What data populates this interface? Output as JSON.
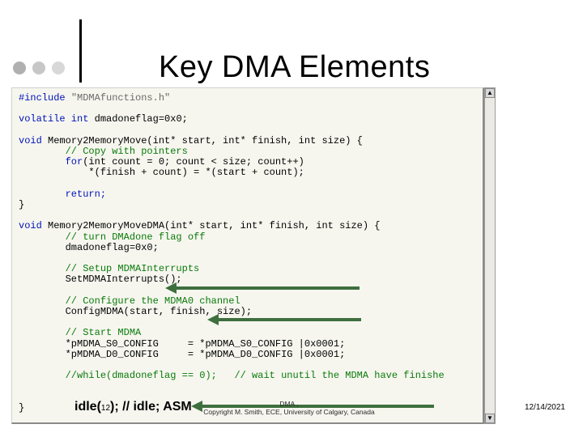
{
  "title": "Key DMA Elements",
  "code": {
    "include_kw": "#include",
    "include_path": "\"MDMAfunctions.h\"",
    "vol_kw": "volatile int",
    "vol_rest": " dmadoneflag=0x0;",
    "fn1_sig_kw": "void",
    "fn1_sig_rest": " Memory2MemoryMove(int* start, int* finish, int size) {",
    "fn1_c1": "// Copy with pointers",
    "fn1_for_kw": "for",
    "fn1_for_rest": "(int count = 0; count < size; count++)",
    "fn1_body": "*(finish + count) = *(start + count);",
    "return_kw": "return;",
    "brace_close": "}",
    "fn2_sig_kw": "void",
    "fn2_sig_rest": " Memory2MemoryMoveDMA(int* start, int* finish, int size) {",
    "fn2_c1": "// turn DMAdone flag off",
    "fn2_l1": "dmadoneflag=0x0;",
    "fn2_c2": "// Setup MDMAInterrupts",
    "fn2_l2": "SetMDMAInterrupts();",
    "fn2_c3": "// Configure the MDMA0 channel",
    "fn2_l3": "ConfigMDMA(start, finish, size);",
    "fn2_c4": "// Start MDMA",
    "fn2_l4a": "*pMDMA_S0_CONFIG",
    "fn2_l4b": "= *pMDMA_S0_CONFIG |0x0001;",
    "fn2_l5a": "*pMDMA_D0_CONFIG",
    "fn2_l5b": "= *pMDMA_D0_CONFIG |0x0001;",
    "fn2_c5a": "//while(dmadoneflag == 0);",
    "fn2_c5b": "// wait unutil the MDMA have finishe"
  },
  "idle": {
    "left": "idle(",
    "num": "12",
    "mid": ");   //  idle; ASM"
  },
  "footer": {
    "line1": "DMA                         ,",
    "line2": "Copyright M. Smith, ECE, University of Calgary, Canada",
    "date": "12/14/2021"
  }
}
